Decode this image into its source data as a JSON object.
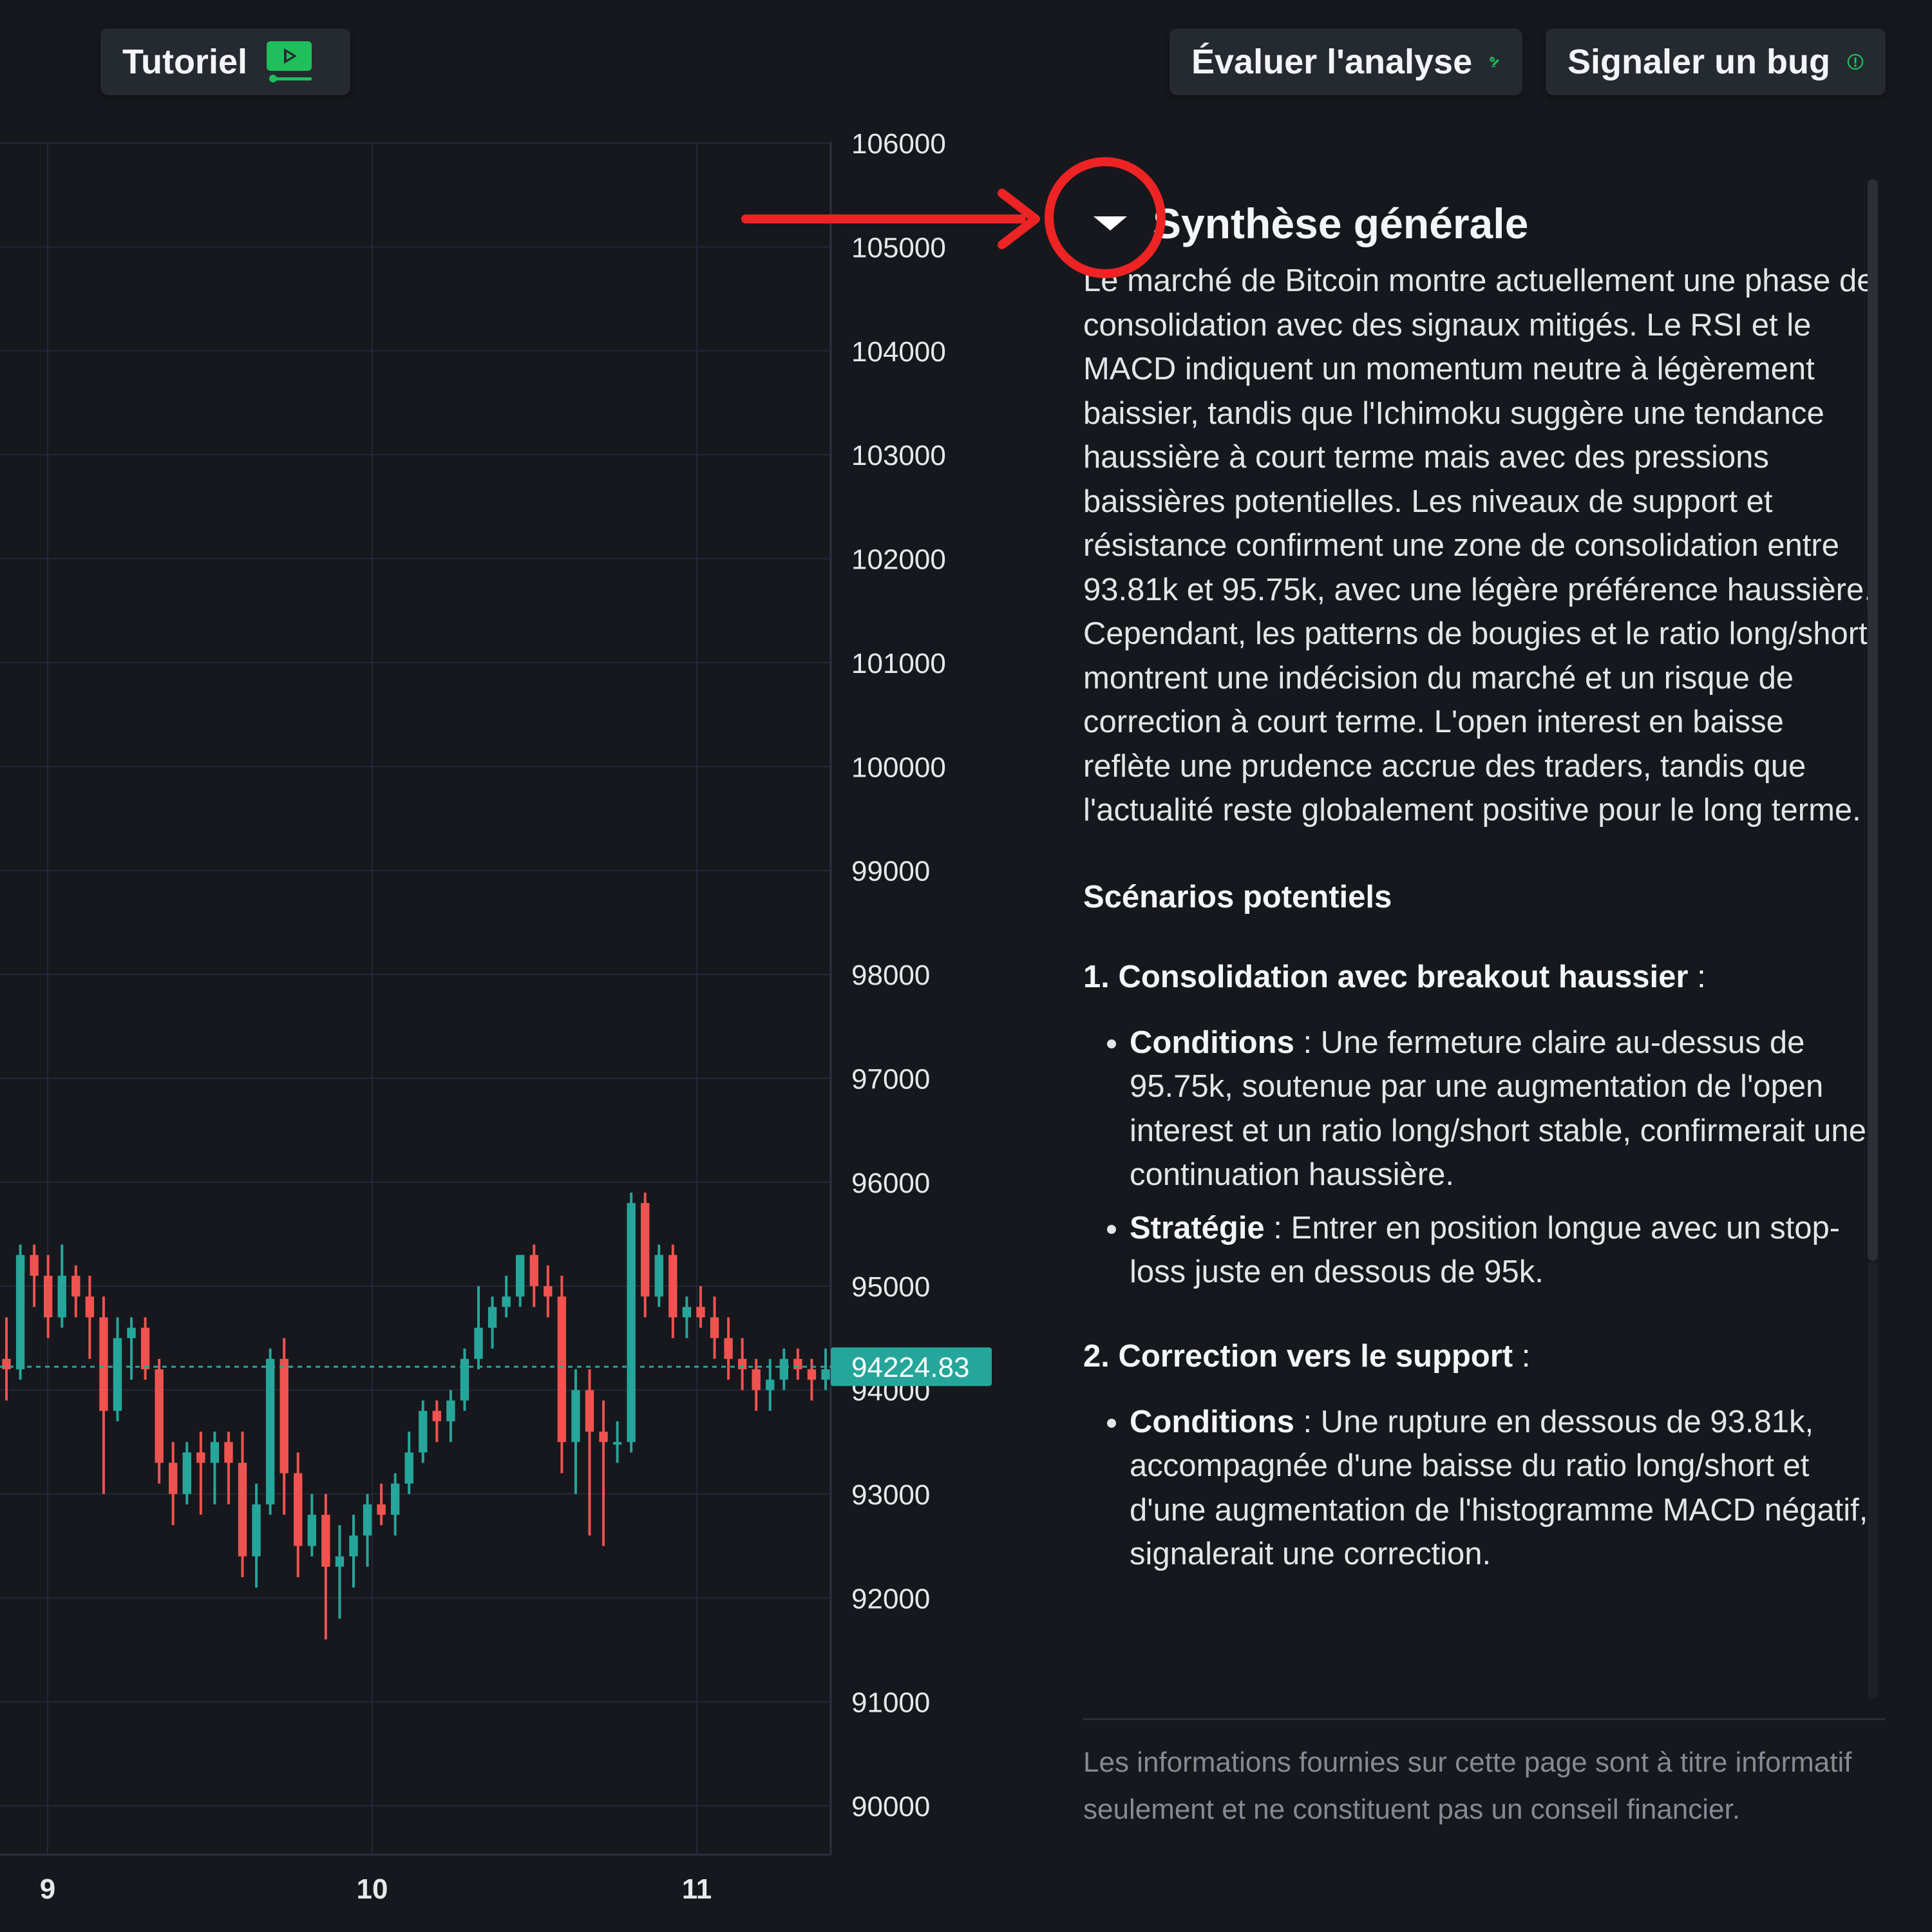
{
  "header": {
    "tutorial_label": "Tutoriel",
    "evaluate_label": "Évaluer l'analyse",
    "report_bug_label": "Signaler un bug"
  },
  "colors": {
    "background": "#16181d",
    "up_candle": "#26a69a",
    "down_candle": "#ef5350",
    "accent_green": "#1fbf5c",
    "annotation_red": "#ee2424"
  },
  "chart_data": {
    "type": "candlestick",
    "y_ticks": [
      "106000",
      "105000",
      "104000",
      "103000",
      "102000",
      "101000",
      "100000",
      "99000",
      "98000",
      "97000",
      "96000",
      "95000",
      "94000",
      "93000",
      "92000",
      "91000",
      "90000"
    ],
    "x_ticks": [
      "9",
      "10",
      "11"
    ],
    "ylim": [
      89600,
      106200
    ],
    "last_price": 94224.83,
    "last_price_label": "94224.83",
    "candles": [
      [
        94300,
        94700,
        93900,
        94200
      ],
      [
        94200,
        95400,
        94100,
        95300
      ],
      [
        95300,
        95400,
        94800,
        95100
      ],
      [
        95100,
        95300,
        94500,
        94700
      ],
      [
        94700,
        95400,
        94600,
        95100
      ],
      [
        95100,
        95200,
        94700,
        94900
      ],
      [
        94900,
        95100,
        94300,
        94700
      ],
      [
        94700,
        94900,
        93000,
        93800
      ],
      [
        93800,
        94700,
        93700,
        94500
      ],
      [
        94500,
        94700,
        94100,
        94600
      ],
      [
        94600,
        94700,
        94100,
        94200
      ],
      [
        94200,
        94300,
        93100,
        93300
      ],
      [
        93300,
        93500,
        92700,
        93000
      ],
      [
        93000,
        93500,
        92900,
        93400
      ],
      [
        93400,
        93600,
        92800,
        93300
      ],
      [
        93300,
        93600,
        92900,
        93500
      ],
      [
        93500,
        93600,
        92900,
        93300
      ],
      [
        93300,
        93600,
        92200,
        92400
      ],
      [
        92400,
        93100,
        92100,
        92900
      ],
      [
        92900,
        94400,
        92800,
        94300
      ],
      [
        94300,
        94500,
        92800,
        93200
      ],
      [
        93200,
        93400,
        92200,
        92500
      ],
      [
        92500,
        93000,
        92400,
        92800
      ],
      [
        92800,
        93000,
        91600,
        92300
      ],
      [
        92300,
        92700,
        91800,
        92400
      ],
      [
        92400,
        92800,
        92100,
        92600
      ],
      [
        92600,
        93000,
        92300,
        92900
      ],
      [
        92900,
        93100,
        92700,
        92800
      ],
      [
        92800,
        93200,
        92600,
        93100
      ],
      [
        93100,
        93600,
        93000,
        93400
      ],
      [
        93400,
        93900,
        93300,
        93800
      ],
      [
        93800,
        93900,
        93500,
        93700
      ],
      [
        93700,
        94000,
        93500,
        93900
      ],
      [
        93900,
        94400,
        93800,
        94300
      ],
      [
        94300,
        95000,
        94200,
        94600
      ],
      [
        94600,
        94900,
        94400,
        94800
      ],
      [
        94800,
        95100,
        94700,
        94900
      ],
      [
        94900,
        95300,
        94800,
        95300
      ],
      [
        95300,
        95400,
        94800,
        95000
      ],
      [
        95000,
        95200,
        94700,
        94900
      ],
      [
        94900,
        95100,
        93200,
        93500
      ],
      [
        93500,
        94200,
        93000,
        94000
      ],
      [
        94000,
        94200,
        92600,
        93600
      ],
      [
        93600,
        93900,
        92500,
        93500
      ],
      [
        93500,
        93700,
        93300,
        93500
      ],
      [
        93500,
        95900,
        93400,
        95800
      ],
      [
        95800,
        95900,
        94700,
        94900
      ],
      [
        94900,
        95400,
        94800,
        95300
      ],
      [
        95300,
        95400,
        94500,
        94700
      ],
      [
        94700,
        94900,
        94500,
        94800
      ],
      [
        94800,
        95000,
        94600,
        94700
      ],
      [
        94700,
        94900,
        94300,
        94500
      ],
      [
        94500,
        94700,
        94100,
        94300
      ],
      [
        94300,
        94500,
        94000,
        94200
      ],
      [
        94200,
        94300,
        93800,
        94000
      ],
      [
        94000,
        94300,
        93800,
        94100
      ],
      [
        94100,
        94400,
        94000,
        94300
      ],
      [
        94300,
        94400,
        94100,
        94200
      ],
      [
        94200,
        94300,
        93900,
        94100
      ],
      [
        94100,
        94400,
        94000,
        94200
      ]
    ]
  },
  "panel": {
    "summary_title": "Synthèse générale",
    "summary_text": "Le marché de Bitcoin montre actuellement une phase de consolidation avec des signaux mitigés. Le RSI et le MACD indiquent un momentum neutre à légèrement baissier, tandis que l'Ichimoku suggère une tendance haussière à court terme mais avec des pressions baissières potentielles. Les niveaux de support et résistance confirment une zone de consolidation entre 93.81k et 95.75k, avec une légère préférence haussière. Cependant, les patterns de bougies et le ratio long/short montrent une indécision du marché et un risque de correction à court terme. L'open interest en baisse reflète une prudence accrue des traders, tandis que l'actualité reste globalement positive pour le long terme.",
    "scenarios_title": "Scénarios potentiels",
    "scenario1": {
      "title": "1. Consolidation avec breakout haussier",
      "suffix": " :",
      "conditions_label": "Conditions",
      "conditions_text": " : Une fermeture claire au-dessus de 95.75k, soutenue par une augmentation de l'open interest et un ratio long/short stable, confirmerait une continuation haussière.",
      "strategy_label": "Stratégie",
      "strategy_text": " : Entrer en position longue avec un stop-loss juste en dessous de 95k."
    },
    "scenario2": {
      "title": "2. Correction vers le support",
      "suffix": " :",
      "conditions_label": "Conditions",
      "conditions_text": " : Une rupture en dessous de 93.81k, accompagnée d'une baisse du ratio long/short et d'une augmentation de l'histogramme MACD négatif, signalerait une correction."
    },
    "disclaimer": "Les informations fournies sur cette page sont à titre informatif seulement et ne constituent pas un conseil financier."
  }
}
